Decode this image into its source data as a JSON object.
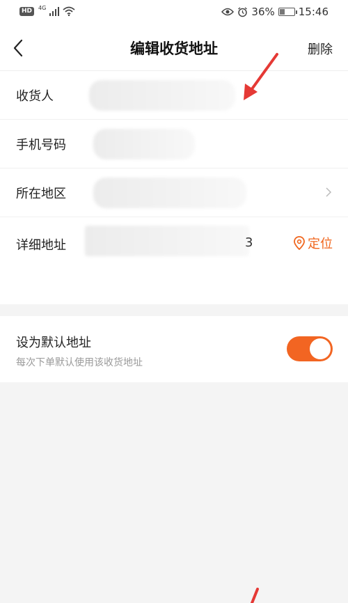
{
  "status_bar": {
    "hd": "HD",
    "network": "4G",
    "battery": "36%",
    "battery_level": 0.36,
    "time": "15:46"
  },
  "nav": {
    "title": "编辑收货地址",
    "action": "删除"
  },
  "form": {
    "recipient_label": "收货人",
    "phone_label": "手机号码",
    "region_label": "所在地区",
    "detail_label": "详细地址",
    "detail_trailing": "3",
    "locate_label": "定位"
  },
  "default_address": {
    "title": "设为默认地址",
    "subtitle": "每次下单默认使用该收货地址",
    "enabled": true
  },
  "colors": {
    "accent": "#f26522",
    "annotation": "#e53935"
  }
}
